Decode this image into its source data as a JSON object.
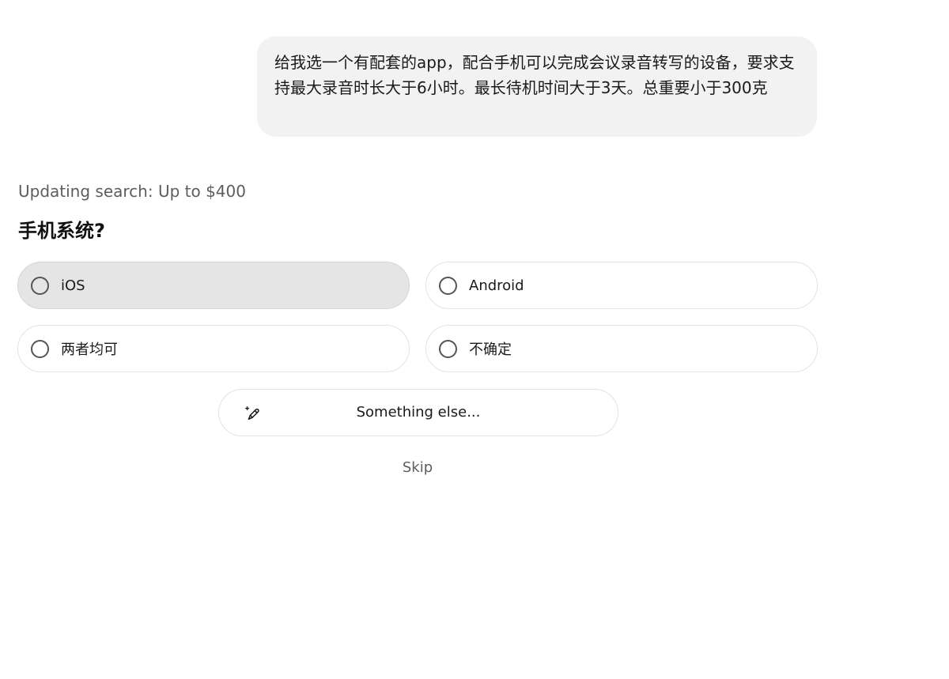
{
  "user_message": {
    "text": "给我选一个有配套的app，配合手机可以完成会议录音转写的设备，要求支持最大录音时长大于6小时。最长待机时间大于3天。总重要小于300克"
  },
  "status": {
    "text": "Updating search: Up to $400"
  },
  "question": {
    "title": "手机系统?",
    "options": [
      {
        "label": "iOS",
        "selected": true
      },
      {
        "label": "Android",
        "selected": false
      },
      {
        "label": "两者均可",
        "selected": false
      },
      {
        "label": "不确定",
        "selected": false
      }
    ],
    "something_else": {
      "label": "Something else...",
      "icon": "pencil-sparkle-icon"
    },
    "skip_label": "Skip"
  }
}
